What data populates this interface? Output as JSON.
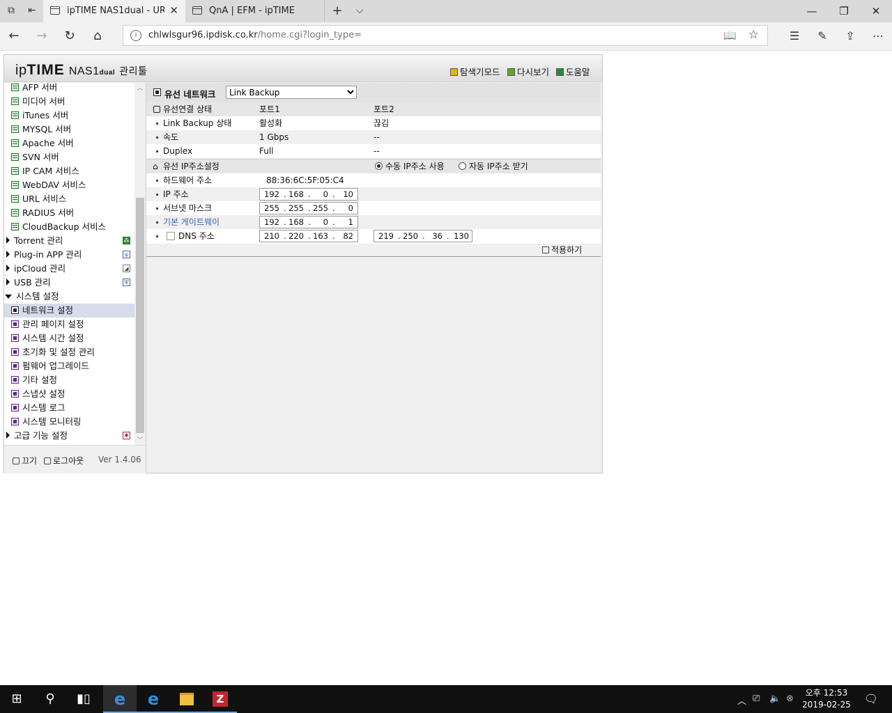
{
  "browser": {
    "tabs": [
      {
        "title": "ipTIME NAS1dual - URK",
        "active": true
      },
      {
        "title": "QnA | EFM - ipTIME",
        "active": false
      }
    ],
    "url_host": "chlwlsgur96.ipdisk.co.kr",
    "url_path": "/home.cgi?login_type="
  },
  "header": {
    "logo_ip": "ip",
    "logo_time": "TIME",
    "logo_nas": "NAS1",
    "logo_dual": "dual",
    "logo_tool": "관리툴",
    "links": [
      "탐색기모드",
      "다시보기",
      "도움말"
    ]
  },
  "sidebar": {
    "services": [
      "AFP 서버",
      "미디어 서버",
      "iTunes 서버",
      "MYSQL 서버",
      "Apache 서버",
      "SVN 서버",
      "IP CAM 서비스",
      "WebDAV 서비스",
      "URL 서비스",
      "RADIUS 서버",
      "CloudBackup 서비스"
    ],
    "groups": [
      "Torrent 관리",
      "Plug-in APP 관리",
      "ipCloud 관리",
      "USB 관리"
    ],
    "system_group": "시스템 설정",
    "system_items": [
      "네트워크 설정",
      "관리 페이지 설정",
      "시스템 시간 설정",
      "초기화 및 설정 관리",
      "펌웨어 업그레이드",
      "기타 설정",
      "스냅샷 설정",
      "시스템 로그",
      "시스템 모니터링"
    ],
    "selected": "네트워크 설정",
    "advanced": "고급 기능 설정",
    "footer": {
      "power": "끄기",
      "logout": "로그아웃",
      "version": "Ver 1.4.06"
    }
  },
  "content": {
    "section_title": "유선 네트워크",
    "mode_select": "Link Backup",
    "status": {
      "header_label": "유선연결 상태",
      "port1": "포트1",
      "port2": "포트2",
      "rows": [
        {
          "label": "Link Backup 상태",
          "p1": "활성화",
          "p2": "끊김"
        },
        {
          "label": "속도",
          "p1": "1 Gbps",
          "p2": "--"
        },
        {
          "label": "Duplex",
          "p1": "Full",
          "p2": "--"
        }
      ]
    },
    "ip": {
      "header_label": "유선 IP주소설정",
      "manual_label": "수동 IP주소 사용",
      "auto_label": "자동 IP주소 받기",
      "mode": "manual",
      "hw_label": "하드웨어 주소",
      "hw_value": "88:36:6C:5F:05:C4",
      "ip_label": "IP 주소",
      "ip": [
        "192",
        "168",
        "0",
        "10"
      ],
      "mask_label": "서브넷 마스크",
      "mask": [
        "255",
        "255",
        "255",
        "0"
      ],
      "gw_label": "기본 게이트웨이",
      "gw": [
        "192",
        "168",
        "0",
        "1"
      ],
      "dns_label": "DNS 주소",
      "dns1": [
        "210",
        "220",
        "163",
        "82"
      ],
      "dns2": [
        "219",
        "250",
        "36",
        "130"
      ]
    },
    "apply_label": "적용하기"
  },
  "taskbar": {
    "time": "오후 12:53",
    "date": "2019-02-25"
  }
}
